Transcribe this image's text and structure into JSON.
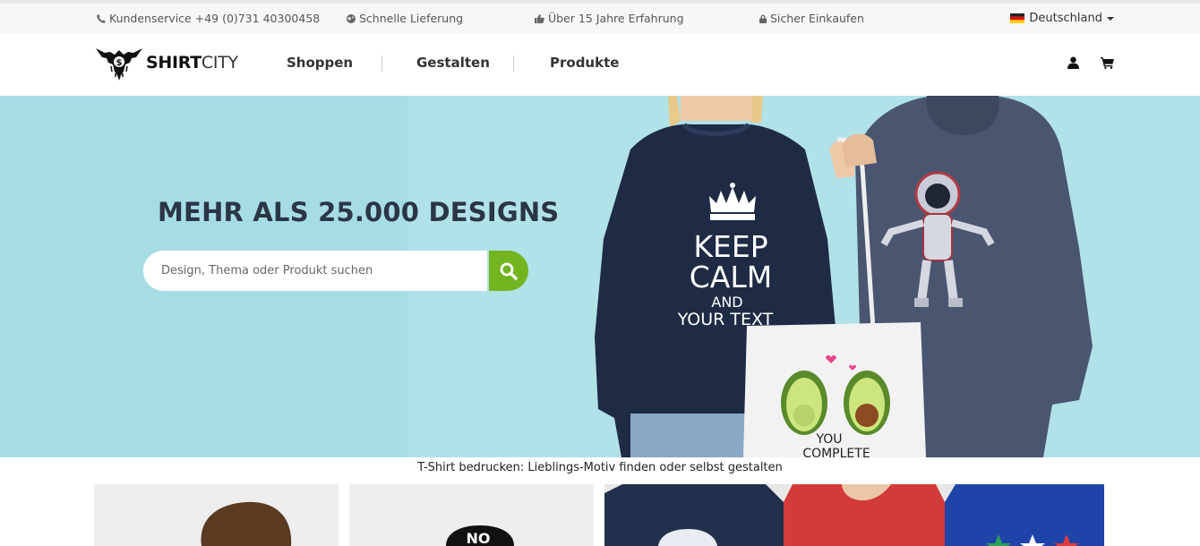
{
  "topbar": {
    "service": "Kundenservice +49 (0)731 40300458",
    "delivery": "Schnelle Lieferung",
    "experience": "Über 15 Jahre Erfahrung",
    "secure": "Sicher Einkaufen",
    "language": "Deutschland"
  },
  "header": {
    "logo_bold": "SHIRT",
    "logo_light": "CITY",
    "nav": [
      "Shoppen",
      "Gestalten",
      "Produkte"
    ]
  },
  "hero": {
    "title": "MEHR ALS 25.000 DESIGNS",
    "search_placeholder": "Design, Thema oder Produkt suchen",
    "sweater_text": [
      "KEEP",
      "CALM",
      "AND",
      "YOUR TEXT"
    ],
    "bag_text": [
      "YOU",
      "COMPLETE"
    ]
  },
  "tagline": "T-Shirt bedrucken: Lieblings-Motiv finden oder selbst gestalten",
  "tiles": {
    "tile2_text": "NO"
  },
  "colors": {
    "accent_green": "#73b520",
    "hero_bg": "#a9dfe6",
    "title_color": "#2b3644"
  },
  "icons": [
    "phone-icon",
    "globe-icon",
    "thumbs-up-icon",
    "lock-icon",
    "flag-de-icon",
    "user-icon",
    "cart-icon",
    "search-icon"
  ]
}
